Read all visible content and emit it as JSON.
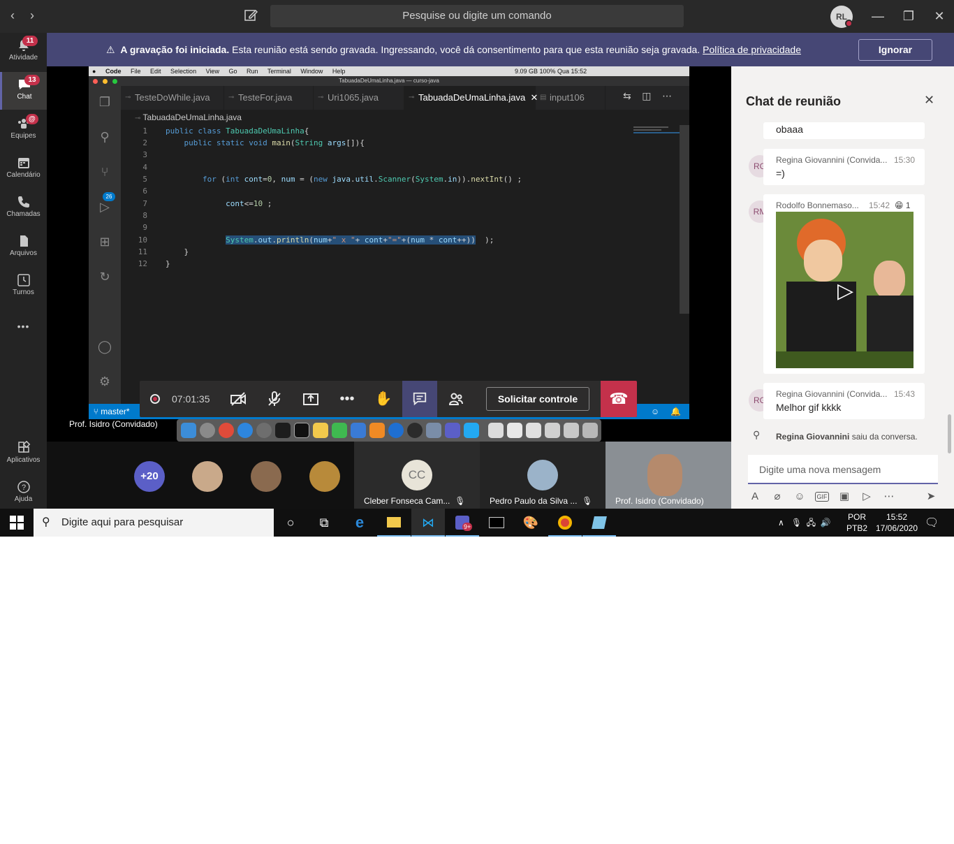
{
  "titlebar": {
    "search_placeholder": "Pesquise ou digite um comando",
    "avatar_initials": "RL"
  },
  "rail": {
    "items": [
      {
        "label": "Atividade",
        "badge": "11",
        "icon": "bell-icon"
      },
      {
        "label": "Chat",
        "badge": "13",
        "icon": "chat-icon"
      },
      {
        "label": "Equipes",
        "badge": "@",
        "icon": "teams-icon"
      },
      {
        "label": "Calendário",
        "badge": "",
        "icon": "calendar-icon"
      },
      {
        "label": "Chamadas",
        "badge": "",
        "icon": "phone-icon"
      },
      {
        "label": "Arquivos",
        "badge": "",
        "icon": "file-icon"
      },
      {
        "label": "Turnos",
        "badge": "",
        "icon": "clock-icon"
      }
    ],
    "more": "•••",
    "apps_label": "Aplicativos",
    "help_label": "Ajuda"
  },
  "banner": {
    "bold": "A gravação foi iniciada.",
    "text": " Esta reunião está sendo gravada. Ingressando, você dá consentimento para que esta reunião seja gravada. ",
    "link": "Política de privacidade",
    "button": "Ignorar"
  },
  "mac": {
    "menu": [
      "Code",
      "File",
      "Edit",
      "Selection",
      "View",
      "Go",
      "Run",
      "Terminal",
      "Window",
      "Help"
    ],
    "right": "9.09 GB     100%     Qua 15:52",
    "window_title": "TabuadaDeUmaLinha.java — curso-java"
  },
  "vscode": {
    "tabs": [
      "TesteDoWhile.java",
      "TesteFor.java",
      "Uri1065.java",
      "TabuadaDeUmaLinha.java",
      "input106"
    ],
    "active_tab": 3,
    "breadcrumb": "TabuadaDeUmaLinha.java",
    "scm_badge": "26",
    "status_branch": "master*",
    "line_numbers": [
      "1",
      "2",
      "3",
      "4",
      "5",
      "6",
      "7",
      "8",
      "9",
      "10",
      "11",
      "12"
    ]
  },
  "meeting": {
    "timer": "07:01:35",
    "request_control": "Solicitar controle",
    "presenter": "Prof. Isidro (Convidado)"
  },
  "participants": {
    "more": "+20",
    "tiles": [
      {
        "initials": "CC",
        "name": "Cleber Fonseca Cam..."
      },
      {
        "name": "Pedro Paulo da Silva ..."
      },
      {
        "name": "Prof. Isidro (Convidado)"
      }
    ]
  },
  "chat": {
    "title": "Chat de reunião",
    "messages": [
      {
        "text": "obaaa"
      },
      {
        "initials": "RG",
        "author": "Regina Giovannini (Convida...",
        "time": "15:30",
        "text": "=)"
      },
      {
        "initials": "RM",
        "author": "Rodolfo Bonnemaso...",
        "time": "15:42",
        "reaction": "1"
      },
      {
        "initials": "RG",
        "author": "Regina Giovannini (Convida...",
        "time": "15:43",
        "text": "Melhor gif kkkk"
      }
    ],
    "system_name": "Regina Giovannini",
    "system_text": " saiu da conversa.",
    "compose_placeholder": "Digite uma nova mensagem"
  },
  "taskbar": {
    "search_placeholder": "Digite aqui para pesquisar",
    "teams_badge": "9+",
    "lang": "POR",
    "layout": "PTB2",
    "time": "15:52",
    "date": "17/06/2020"
  },
  "colors": {
    "teams_purple": "#464775",
    "accent": "#6264a7",
    "hangup": "#c4314b",
    "vscode_blue": "#007acc"
  }
}
